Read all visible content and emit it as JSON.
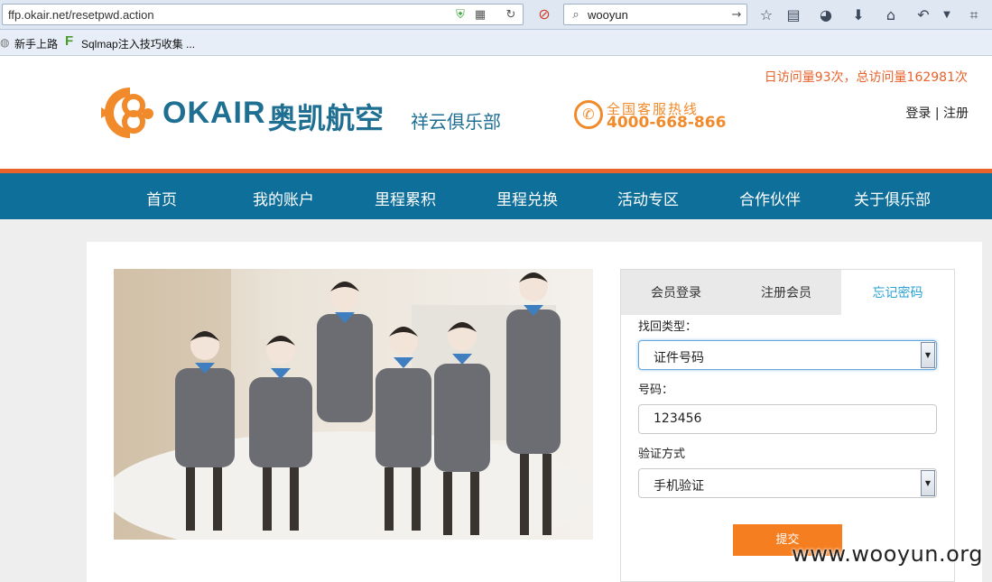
{
  "browser": {
    "url": "ffp.okair.net/resetpwd.action",
    "search_query": "wooyun",
    "bookmarks": [
      "新手上路",
      "Sqlmap注入技巧收集 ..."
    ]
  },
  "header": {
    "visit_stats": "日访问量93次，总访问量162981次",
    "logo_text": "OKAIR",
    "logo_cn": "奥凯航空",
    "club_name": "祥云俱乐部",
    "hotline_label": "全国客服热线",
    "hotline_number": "4000-668-866",
    "login": "登录",
    "separator": "|",
    "register": "注册"
  },
  "nav": {
    "items": [
      "首页",
      "我的账户",
      "里程累积",
      "里程兑换",
      "活动专区",
      "合作伙伴",
      "关于俱乐部"
    ]
  },
  "form": {
    "tabs": [
      "会员登录",
      "注册会员",
      "忘记密码"
    ],
    "active_tab": "忘记密码",
    "recover_type_label": "找回类型：",
    "recover_type_value": "证件号码",
    "number_label": "号码：",
    "number_value": "123456",
    "verify_label": "验证方式",
    "verify_value": "手机验证",
    "submit_label": "提交"
  },
  "watermark": "www.wooyun.org",
  "colors": {
    "brand_blue": "#1f6f93",
    "nav_blue": "#0f6f9b",
    "accent_orange": "#e8622a",
    "button_orange": "#f57e20",
    "active_tab_text": "#2aa2d6"
  }
}
